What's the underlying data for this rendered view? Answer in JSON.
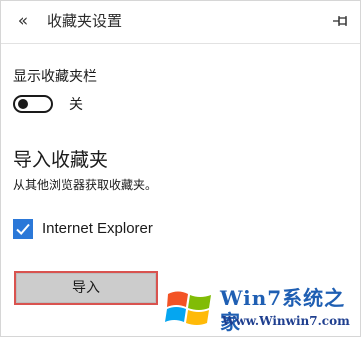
{
  "header": {
    "back_glyph": "«",
    "title": "收藏夹设置",
    "pin_icon": "pin-icon"
  },
  "favorites_bar": {
    "label": "显示收藏夹栏",
    "toggle_on": false,
    "toggle_state_label": "关"
  },
  "import_section": {
    "heading": "导入收藏夹",
    "description": "从其他浏览器获取收藏夹。",
    "sources": [
      {
        "label": "Internet Explorer",
        "checked": true
      }
    ],
    "import_button_label": "导入"
  },
  "watermark": {
    "title": "Win7系统之家",
    "url": "Www.Winwin7.com"
  },
  "colors": {
    "accent": "#2b78d8",
    "button_highlight": "#d9534f",
    "button_bg": "#cccccc"
  }
}
